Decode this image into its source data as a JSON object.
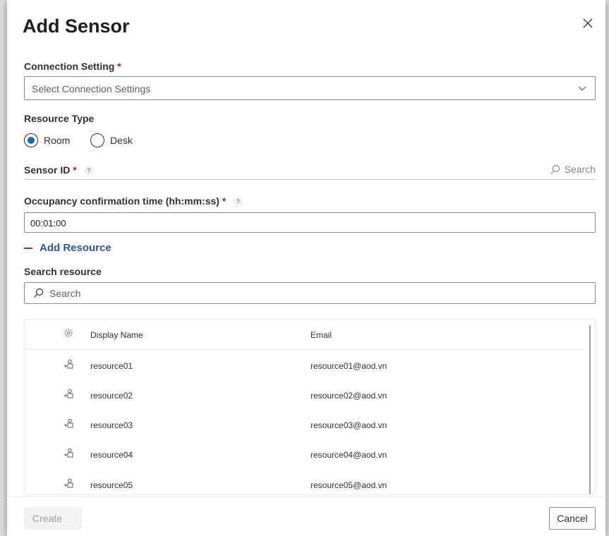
{
  "dialog": {
    "title": "Add Sensor",
    "close_icon": "close-icon"
  },
  "connection": {
    "label": "Connection Setting",
    "required": "*",
    "placeholder": "Select Connection Settings"
  },
  "resource_type": {
    "label": "Resource Type",
    "options": [
      {
        "label": "Room",
        "selected": true
      },
      {
        "label": "Desk",
        "selected": false
      }
    ]
  },
  "sensor": {
    "label": "Sensor ID",
    "required": "*",
    "help": "?",
    "search_label": "Search"
  },
  "occupancy": {
    "label": "Occupancy confirmation time (hh:mm:ss)",
    "required": "*",
    "help": "?",
    "value": "00:01:00"
  },
  "add_resource": {
    "label": "Add Resource"
  },
  "search_resource": {
    "label": "Search resource",
    "placeholder": "Search"
  },
  "table": {
    "columns": {
      "name": "Display Name",
      "email": "Email"
    },
    "rows": [
      {
        "name": "resource01",
        "email": "resource01@aod.vn"
      },
      {
        "name": "resource02",
        "email": "resource02@aod.vn"
      },
      {
        "name": "resource03",
        "email": "resource03@aod.vn"
      },
      {
        "name": "resource04",
        "email": "resource04@aod.vn"
      },
      {
        "name": "resource05",
        "email": "resource05@aod.vn"
      }
    ]
  },
  "footer": {
    "create_label": "Create",
    "cancel_label": "Cancel"
  },
  "colors": {
    "accent": "#0f6cbd",
    "link": "#2b579a",
    "required": "#a4262c"
  }
}
